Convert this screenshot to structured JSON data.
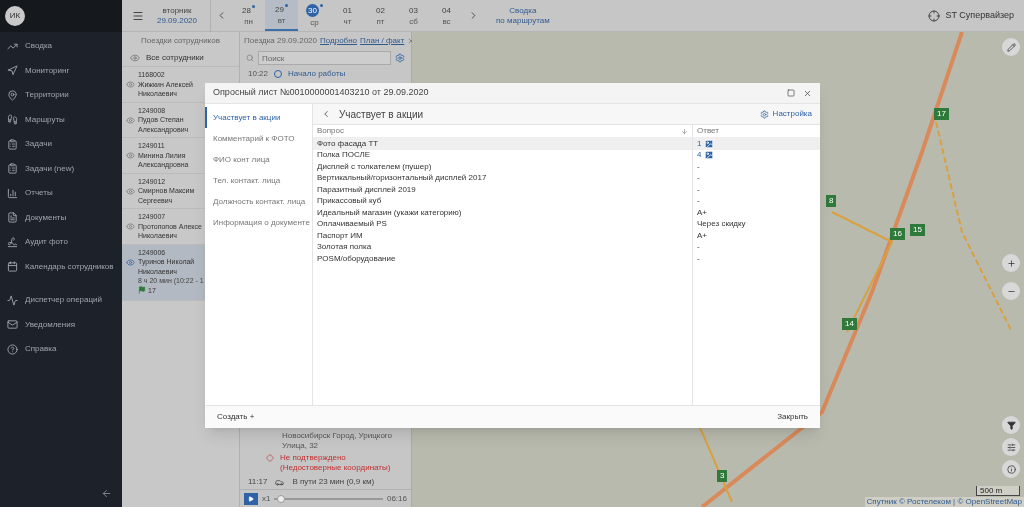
{
  "sidebar": {
    "avatar": "ИК",
    "items": [
      {
        "label": "Сводка"
      },
      {
        "label": "Мониторинг"
      },
      {
        "label": "Территории"
      },
      {
        "label": "Маршруты"
      },
      {
        "label": "Задачи"
      },
      {
        "label": "Задачи (new)"
      },
      {
        "label": "Отчеты"
      },
      {
        "label": "Документы"
      },
      {
        "label": "Аудит фото"
      },
      {
        "label": "Календарь сотрудников"
      },
      {
        "label": "Диспетчер операций"
      },
      {
        "label": "Уведомления"
      },
      {
        "label": "Справка"
      }
    ]
  },
  "topbar": {
    "weekday": "вторник",
    "date": "29.09.2020",
    "days": [
      {
        "day": "28",
        "weekday": "пн",
        "dot": true,
        "selected": false,
        "today": false
      },
      {
        "day": "29",
        "weekday": "вт",
        "dot": true,
        "selected": true,
        "today": false
      },
      {
        "day": "30",
        "weekday": "ср",
        "dot": true,
        "selected": false,
        "today": true
      },
      {
        "day": "01",
        "weekday": "чт",
        "dot": false,
        "selected": false,
        "today": false
      },
      {
        "day": "02",
        "weekday": "пт",
        "dot": false,
        "selected": false,
        "today": false
      },
      {
        "day": "03",
        "weekday": "сб",
        "dot": false,
        "selected": false,
        "today": false
      },
      {
        "day": "04",
        "weekday": "вс",
        "dot": false,
        "selected": false,
        "today": false
      }
    ],
    "summary_link": [
      "Сводка",
      "по маршрутам"
    ],
    "user": "ST Супервайзер"
  },
  "employees": {
    "title": "Поездки сотрудников",
    "all_label": "Все сотрудники",
    "items": [
      {
        "id": "1168002",
        "name": [
          "Жижкин Алексей",
          "Николаевич"
        ],
        "selected": false
      },
      {
        "id": "1249008",
        "name": [
          "Пудов Степан",
          "Александрович"
        ],
        "selected": false
      },
      {
        "id": "1249011",
        "name": [
          "Минина Лилия",
          "Александровна"
        ],
        "selected": false
      },
      {
        "id": "1249012",
        "name": [
          "Смирнов Максим",
          "Сергеевич"
        ],
        "selected": false
      },
      {
        "id": "1249007",
        "name": [
          "Протопопов Алексе",
          "Николаевич"
        ],
        "selected": false
      },
      {
        "id": "1249006",
        "name": [
          "Туринов Николай",
          "Николаевич"
        ],
        "selected": true,
        "duration": "8 ч 20 мин (10:22 - 1",
        "flags": "17"
      }
    ]
  },
  "trip": {
    "title": "Поездка 29.09.2020",
    "links": [
      "Подробно",
      "План / факт"
    ],
    "search_placeholder": "Поиск",
    "first_event": {
      "time": "10:22",
      "label": "Начало работы"
    },
    "address": "Новосибирск Город, Урицкого Улица, 32",
    "warning": "Не подтверждено (Недостоверные координаты)",
    "last_event": {
      "time": "11:17",
      "label": "В пути 23 мин (0,9 км)"
    },
    "player": {
      "speed": "x1",
      "time": "06:16",
      "level": 0.03
    }
  },
  "map": {
    "markers": [
      {
        "label": "17"
      },
      {
        "label": "8"
      },
      {
        "label": "16"
      },
      {
        "label": "15"
      },
      {
        "label": "14"
      },
      {
        "label": "3"
      }
    ],
    "scale": "500 m",
    "attribution": "Спутник © Ростелеком | © OpenStreetMap"
  },
  "modal": {
    "title": "Опросный лист №0010000001403210 от 29.09.2020",
    "tabs": [
      {
        "label": "Участвует в акции",
        "selected": true
      },
      {
        "label": "Комментарий к ФОТО",
        "selected": false
      },
      {
        "label": "ФИО конт лица",
        "selected": false
      },
      {
        "label": "Тел. контакт. лица",
        "selected": false
      },
      {
        "label": "Должность контакт. лица",
        "selected": false
      },
      {
        "label": "Информация о документе",
        "selected": false
      }
    ],
    "section_title": "Участвует в акции",
    "settings_label": "Настройка",
    "columns": [
      "Вопрос",
      "Ответ"
    ],
    "rows": [
      {
        "question": "Фото фасада ТТ",
        "answer": {
          "kind": "photos",
          "text": "1"
        },
        "selected": true
      },
      {
        "question": "Полка ПОСЛЕ",
        "answer": {
          "kind": "photos",
          "text": "4"
        },
        "selected": false
      },
      {
        "question": "Дисплей с толкателем (пушер)",
        "answer": {
          "kind": "text",
          "text": "-"
        },
        "selected": false
      },
      {
        "question": "Вертикальный/горизонтальный дисплей 2017",
        "answer": {
          "kind": "text",
          "text": "-"
        },
        "selected": false
      },
      {
        "question": "Паразитный дисплей 2019",
        "answer": {
          "kind": "text",
          "text": "-"
        },
        "selected": false
      },
      {
        "question": "Прикассовый куб",
        "answer": {
          "kind": "text",
          "text": "-"
        },
        "selected": false
      },
      {
        "question": "Идеальный магазин (укажи категорию)",
        "answer": {
          "kind": "text",
          "text": "А+"
        },
        "selected": false
      },
      {
        "question": "Оплачиваемый PS",
        "answer": {
          "kind": "text",
          "text": "Через скидку"
        },
        "selected": false
      },
      {
        "question": "Паспорт ИМ",
        "answer": {
          "kind": "text",
          "text": "А+"
        },
        "selected": false
      },
      {
        "question": "Золотая полка",
        "answer": {
          "kind": "text",
          "text": "-"
        },
        "selected": false
      },
      {
        "question": "POSM/оборудование",
        "answer": {
          "kind": "text",
          "text": "-"
        },
        "selected": false
      }
    ],
    "create_label": "Создать +",
    "close_label": "Закрыть"
  }
}
